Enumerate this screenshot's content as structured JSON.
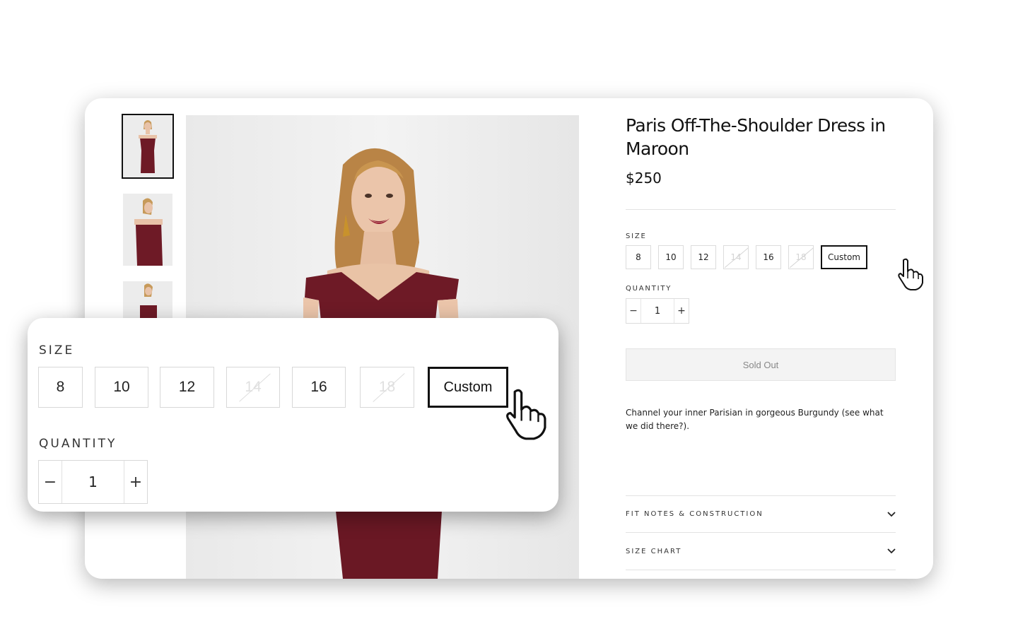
{
  "product": {
    "title": "Paris Off-The-Shoulder Dress in Maroon",
    "price": "$250",
    "size_label": "SIZE",
    "sizes": [
      {
        "label": "8",
        "available": true
      },
      {
        "label": "10",
        "available": true
      },
      {
        "label": "12",
        "available": true
      },
      {
        "label": "14",
        "available": false
      },
      {
        "label": "16",
        "available": true
      },
      {
        "label": "18",
        "available": false
      },
      {
        "label": "Custom",
        "available": true,
        "selected": true
      }
    ],
    "quantity_label": "QUANTITY",
    "quantity": {
      "minus": "−",
      "value": "1",
      "plus": "+"
    },
    "sold_out_button": "Sold Out",
    "description": "Channel your inner Parisian in gorgeous Burgundy (see what we did there?).",
    "accordion": [
      {
        "label": "FIT NOTES & CONSTRUCTION",
        "icon": "chevron-down-icon"
      },
      {
        "label": "SIZE CHART",
        "icon": "chevron-down-icon"
      }
    ]
  },
  "gallery": {
    "thumbnail_count": 3,
    "active_thumbnail": 1
  },
  "zoom_callout": {
    "size_label": "SIZE",
    "quantity_label": "QUANTITY"
  },
  "colors": {
    "dress": "#6e1a26",
    "background": "#ffffff",
    "selected_border": "#111111"
  }
}
